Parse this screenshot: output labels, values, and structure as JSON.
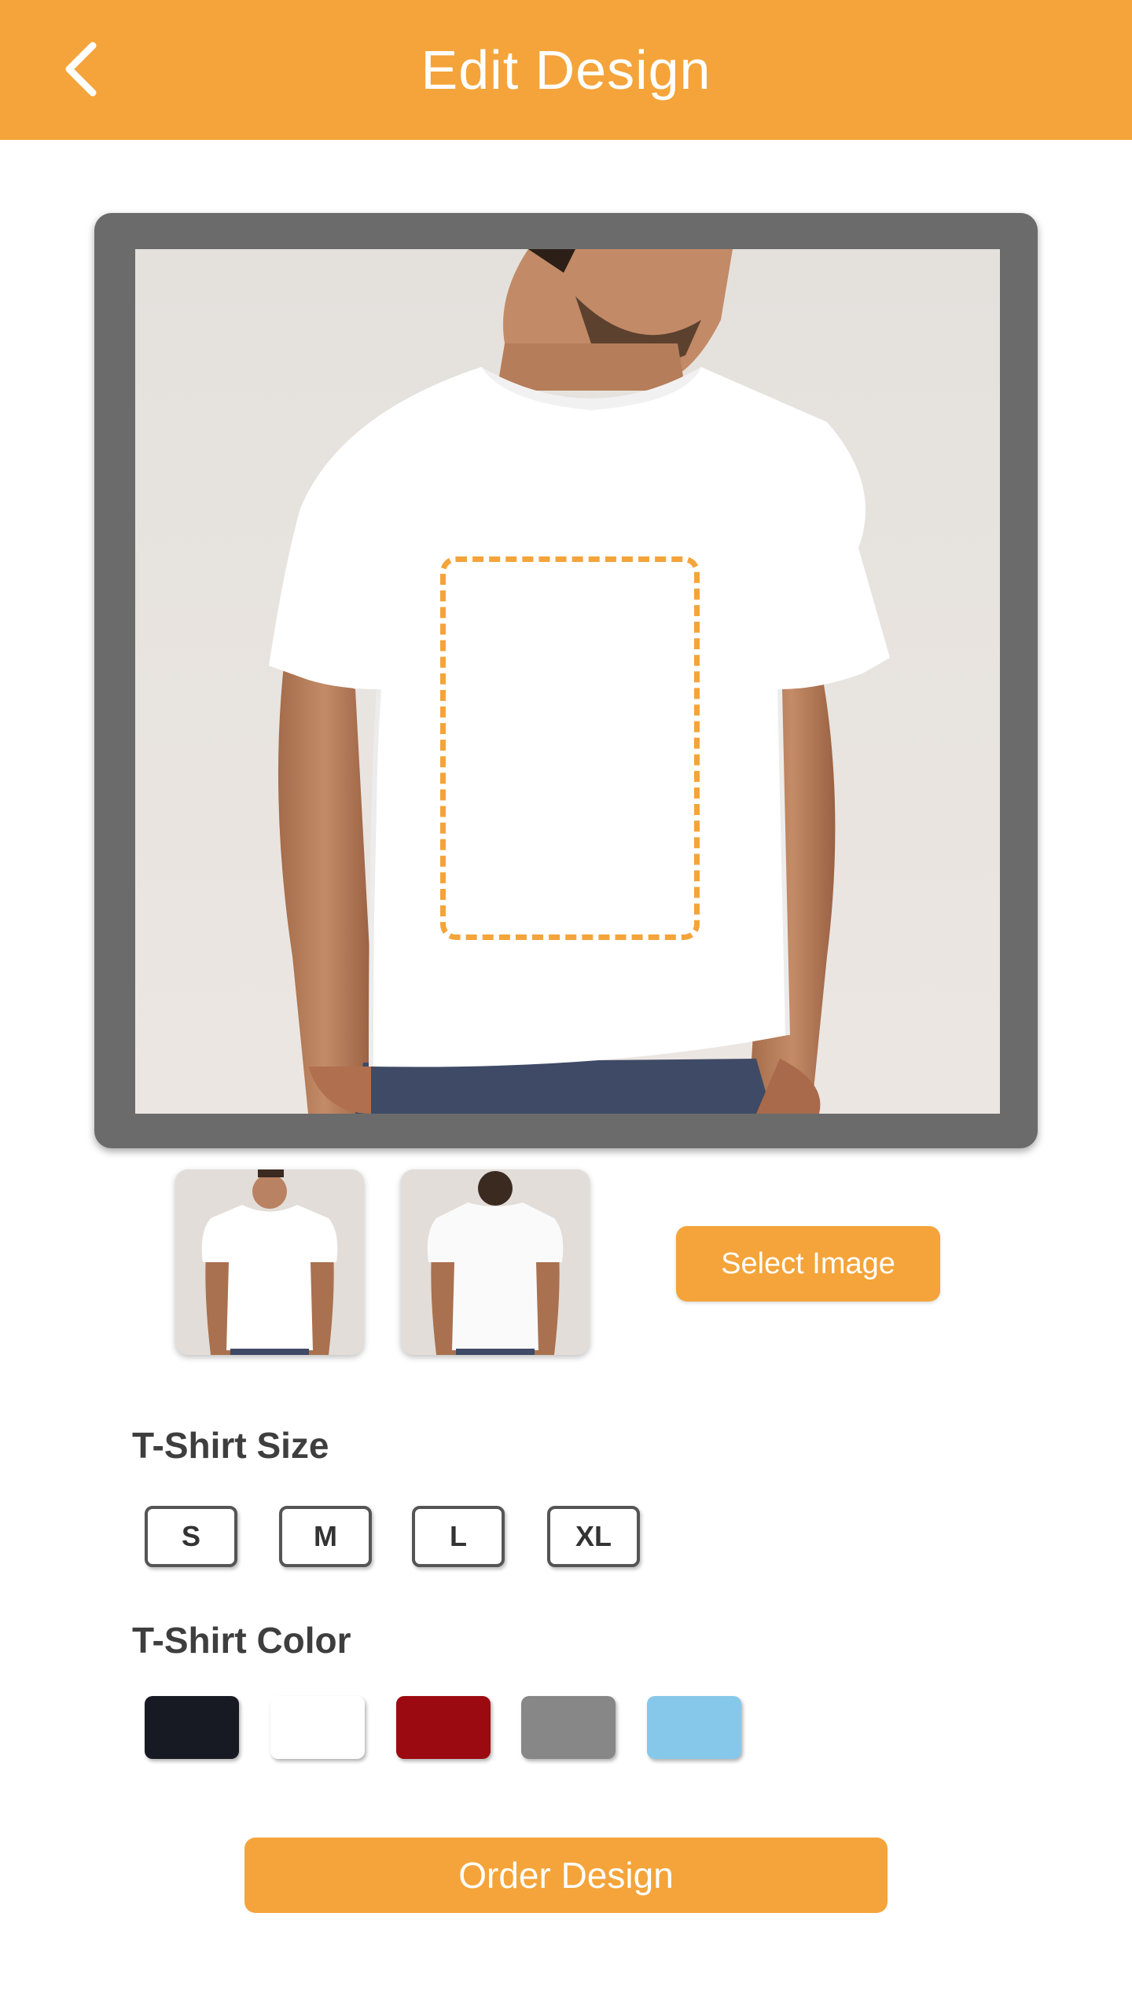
{
  "header": {
    "title": "Edit Design",
    "back_icon": "chevron-left-icon"
  },
  "preview": {
    "image": "man wearing white t-shirt, front view",
    "print_area": "dashed print area"
  },
  "thumbnails": [
    {
      "view": "front"
    },
    {
      "view": "back"
    }
  ],
  "select_image_label": "Select Image",
  "size": {
    "label": "T-Shirt Size",
    "options": [
      "S",
      "M",
      "L",
      "XL"
    ]
  },
  "color": {
    "label": "T-Shirt Color",
    "options": [
      "#171a22",
      "#ffffff",
      "#9b0a10",
      "#878787",
      "#86c8ea"
    ]
  },
  "order_label": "Order Design",
  "theme": {
    "accent": "#F4A43A"
  }
}
